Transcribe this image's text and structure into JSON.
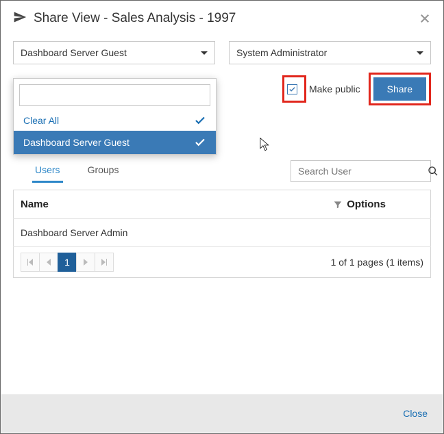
{
  "header": {
    "title": "Share View - Sales Analysis - 1997"
  },
  "selectors": {
    "guest_label": "Dashboard Server Guest",
    "admin_label": "System Administrator"
  },
  "actions": {
    "make_public_label": "Make public",
    "share_label": "Share",
    "close_label": "Close"
  },
  "dropdown": {
    "clear_all": "Clear All",
    "selected_item": "Dashboard Server Guest"
  },
  "tabs": {
    "users": "Users",
    "groups": "Groups"
  },
  "search": {
    "placeholder": "Search User"
  },
  "table": {
    "col_name": "Name",
    "col_options": "Options",
    "rows": [
      {
        "name": "Dashboard Server Admin"
      }
    ]
  },
  "pager": {
    "current": "1",
    "info": "1 of 1 pages (1 items)"
  }
}
